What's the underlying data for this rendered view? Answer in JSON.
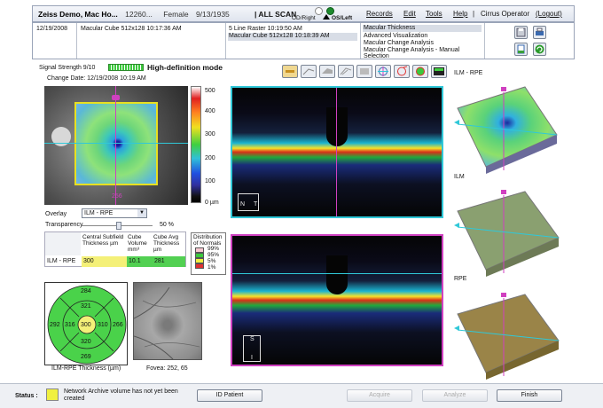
{
  "title": {
    "patient": "Zeiss Demo, Mac Ho...",
    "id": "12260...",
    "sex": "Female",
    "dob": "9/13/1935",
    "scan_mode": "| ALL SCAN",
    "od": "OD/Right",
    "os": "OS/Left"
  },
  "menu": {
    "records": "Records",
    "edit": "Edit",
    "tools": "Tools",
    "help": "Help",
    "operator": "Cirrus Operator",
    "logout": "(Logout)"
  },
  "info": {
    "date": "12/19/2008",
    "scan1": "Macular Cube 512x128   10:17:36 AM",
    "scan2": "5 Line Raster   10:19:50 AM",
    "scan3": "Macular Cube 512x128   10:18:39 AM",
    "analyses": [
      "Macular Thickness",
      "Advanced Visualization",
      "Macular Change Analysis",
      "Macular Change Analysis - Manual Selection"
    ]
  },
  "left": {
    "signal": "Signal Strength  9/10",
    "hd_mode": "High-definition mode",
    "change_date": "Change Date:  12/19/2008 10:19 AM",
    "scale": [
      "500",
      "400",
      "300",
      "200",
      "100",
      "0 µm"
    ],
    "pink_value": "256",
    "overlay_label": "Overlay",
    "overlay_value": "ILM - RPE",
    "transparency_label": "Transparency",
    "transparency_value": "50 %",
    "transparency_level": 50,
    "table_headers": [
      "Central Subfield Thickness µm",
      "Cube Volume mm³",
      "Cube Avg Thickness µm"
    ],
    "row_label": "ILM - RPE",
    "row_values": [
      "300",
      "10.1",
      "281"
    ],
    "dist_title": "Distribution of Normals",
    "dist_items": [
      "99%",
      "95%",
      "5%",
      "1%"
    ],
    "dist_colors": [
      "#f8c8d0",
      "#ffffff",
      "#3cc83c",
      "#f0f040",
      "#e03030"
    ],
    "etdrs": {
      "center": "300",
      "inner_top": "321",
      "inner_left": "316",
      "inner_right": "310",
      "inner_bottom": "320",
      "outer_top": "284",
      "outer_left": "292",
      "outer_right": "266",
      "outer_bottom": "269"
    },
    "etdrs_caption": "ILM-RPE Thickness (µm)",
    "fovea_caption": "Fovea:  252, 65"
  },
  "oct": {
    "n_label": "N",
    "t_label": "T",
    "s_label": "S",
    "i_label": "I"
  },
  "right": {
    "label1": "ILM - RPE",
    "label2": "ILM",
    "label3": "RPE"
  },
  "status": {
    "label": "Status :",
    "message": "Network Archive volume has not yet been created",
    "id_patient": "ID Patient",
    "acquire": "Acquire",
    "analyze": "Analyze",
    "finish": "Finish"
  }
}
